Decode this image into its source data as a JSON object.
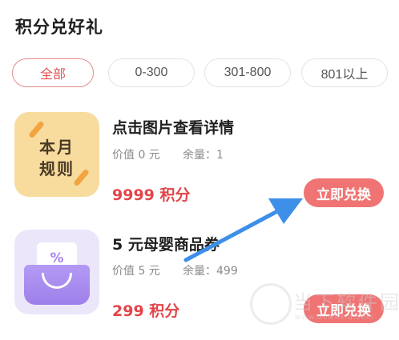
{
  "page": {
    "title": "积分兑好礼"
  },
  "filters": [
    {
      "label": "全部",
      "active": true
    },
    {
      "label": "0-300",
      "active": false
    },
    {
      "label": "301-800",
      "active": false
    },
    {
      "label": "801以上",
      "active": false
    }
  ],
  "items": [
    {
      "name": "点击图片查看详情",
      "value_text": "价值 0 元",
      "stock_text": "余量：1",
      "points_text": "9999 积分",
      "button_label": "立即兑换",
      "thumb_line1": "本月",
      "thumb_line2": "规则"
    },
    {
      "name": "5 元母婴商品券",
      "value_text": "价值 5 元",
      "stock_text": "余量：499",
      "points_text": "299 积分",
      "button_label": "立即兑换",
      "thumb_badge": "%"
    }
  ],
  "watermark": {
    "text": "当下软件园",
    "sub": "www.downxia.com"
  },
  "colors": {
    "accent": "#f07474",
    "points": "#e2454a",
    "annotation_arrow": "#3d8fe8"
  }
}
